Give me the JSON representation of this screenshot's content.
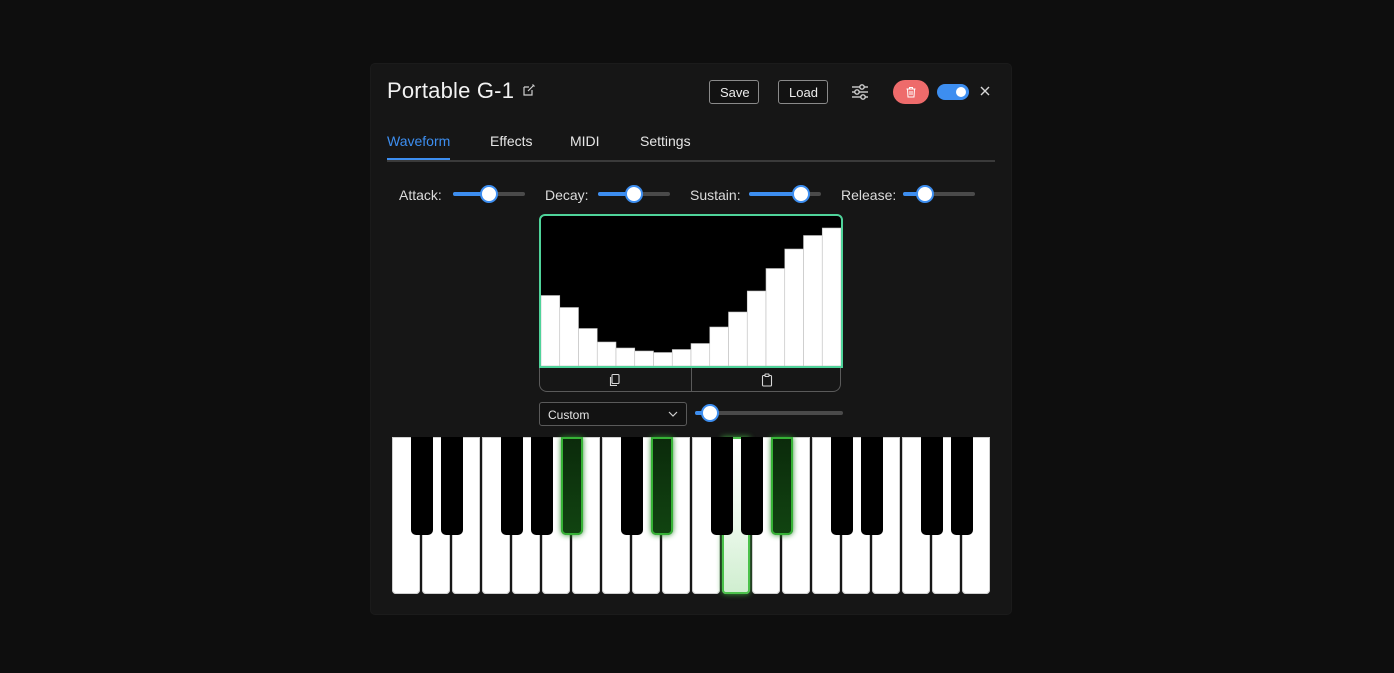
{
  "header": {
    "title": "Portable G-1",
    "save_label": "Save",
    "load_label": "Load",
    "toggle_on": true
  },
  "tabs": [
    {
      "label": "Waveform",
      "active": true
    },
    {
      "label": "Effects",
      "active": false
    },
    {
      "label": "MIDI",
      "active": false
    },
    {
      "label": "Settings",
      "active": false
    }
  ],
  "envelope": [
    {
      "label": "Attack:",
      "value": 0.5
    },
    {
      "label": "Decay:",
      "value": 0.5
    },
    {
      "label": "Sustain:",
      "value": 0.72
    },
    {
      "label": "Release:",
      "value": 0.3
    }
  ],
  "waveform": {
    "samples": [
      0.47,
      0.39,
      0.25,
      0.16,
      0.12,
      0.1,
      0.09,
      0.11,
      0.15,
      0.26,
      0.36,
      0.5,
      0.65,
      0.78,
      0.87,
      0.92
    ]
  },
  "preset": {
    "selected": "Custom",
    "slider_value": 0.1
  },
  "keyboard": {
    "white_keys": 20,
    "active_white": [
      11
    ],
    "active_black": [
      4,
      6,
      9
    ]
  },
  "colors": {
    "accent": "#3d8ef0",
    "danger": "#ee6b6b",
    "wave_border": "#4fd39a",
    "key_active": "#4bc24b"
  },
  "icons": [
    "edit-icon",
    "sliders-icon",
    "trash-icon",
    "close-icon",
    "copy-icon",
    "paste-icon",
    "chevron-down-icon"
  ]
}
